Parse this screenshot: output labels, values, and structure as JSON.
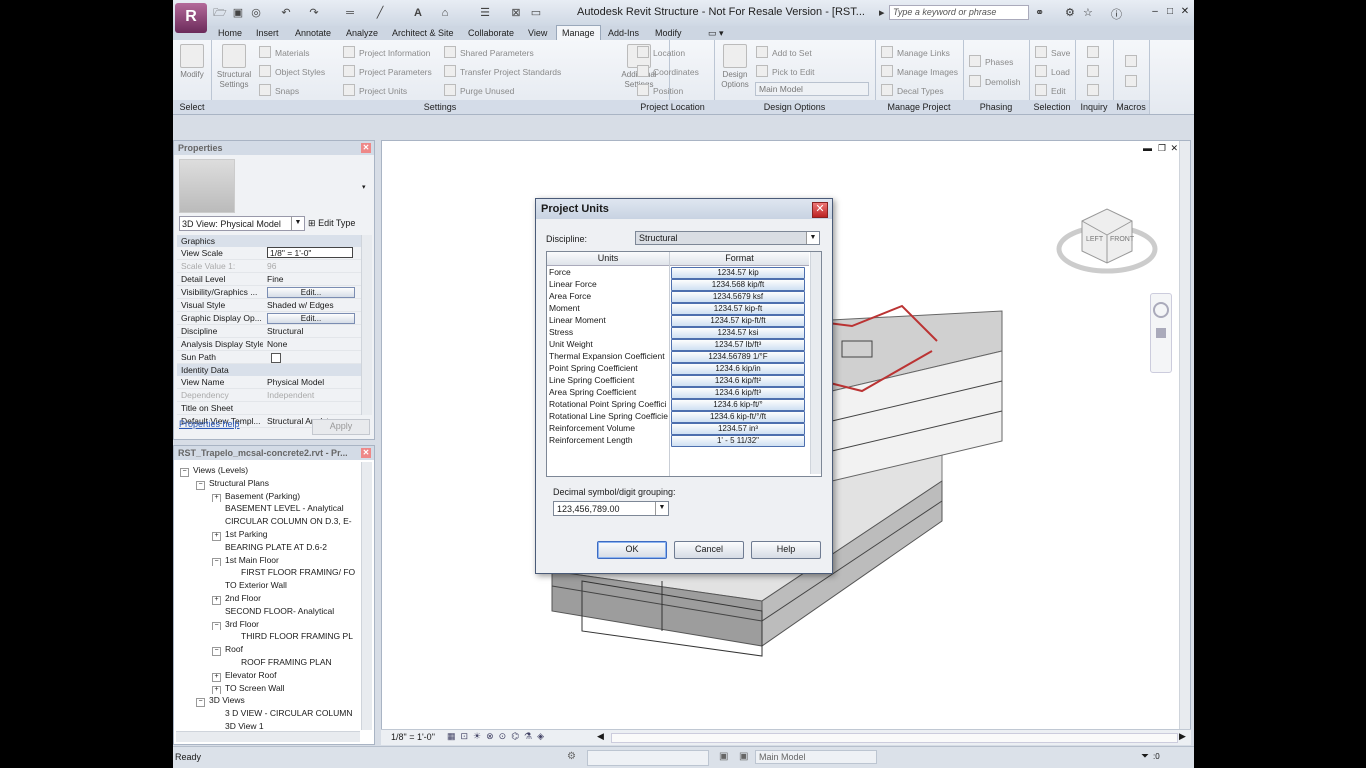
{
  "titlebar": {
    "app_letter": "R",
    "title": "Autodesk Revit Structure - Not For Resale Version - [RST...",
    "search_placeholder": "Type a keyword or phrase"
  },
  "tabs": [
    "Home",
    "Insert",
    "Annotate",
    "Analyze",
    "Architect & Site",
    "Collaborate",
    "View",
    "Manage",
    "Add-Ins",
    "Modify"
  ],
  "active_tab": "Manage",
  "ribbon": {
    "select": {
      "title": "Select",
      "modify": "Modify"
    },
    "settings": {
      "title": "Settings",
      "structural_settings": "Structural Settings",
      "materials": "Materials",
      "object_styles": "Object Styles",
      "snaps": "Snaps",
      "project_information": "Project Information",
      "project_parameters": "Project Parameters",
      "project_units": "Project Units",
      "shared_parameters": "Shared Parameters",
      "transfer_standards": "Transfer Project Standards",
      "purge_unused": "Purge Unused",
      "additional_settings": "Additional Settings"
    },
    "project_location": {
      "title": "Project Location",
      "location": "Location",
      "coordinates": "Coordinates",
      "position": "Position"
    },
    "design_options": {
      "title": "Design Options",
      "design_options": "Design Options",
      "add_to_set": "Add to Set",
      "pick_to_edit": "Pick to Edit",
      "main_model": "Main Model"
    },
    "manage_project": {
      "title": "Manage Project",
      "manage_links": "Manage Links",
      "manage_images": "Manage Images",
      "decal_types": "Decal Types"
    },
    "phasing": {
      "title": "Phasing",
      "phases": "Phases",
      "demolish": "Demolish"
    },
    "selection": {
      "title": "Selection",
      "save": "Save",
      "load": "Load",
      "edit": "Edit"
    },
    "inquiry": {
      "title": "Inquiry"
    },
    "macros": {
      "title": "Macros"
    }
  },
  "properties": {
    "title": "Properties",
    "type": "3D View: Physical Model",
    "edit_type": "Edit Type",
    "groups": [
      {
        "name": "Graphics",
        "rows": [
          {
            "k": "View Scale",
            "v": "1/8\" = 1'-0\"",
            "kind": "input"
          },
          {
            "k": "Scale Value    1:",
            "v": "96",
            "kind": "grey"
          },
          {
            "k": "Detail Level",
            "v": "Fine"
          },
          {
            "k": "Visibility/Graphics ...",
            "v": "Edit...",
            "kind": "button"
          },
          {
            "k": "Visual Style",
            "v": "Shaded w/ Edges"
          },
          {
            "k": "Graphic Display Op...",
            "v": "Edit...",
            "kind": "button"
          },
          {
            "k": "Discipline",
            "v": "Structural"
          },
          {
            "k": "Analysis Display Style",
            "v": "None"
          },
          {
            "k": "Sun Path",
            "v": "",
            "kind": "check"
          }
        ]
      },
      {
        "name": "Identity Data",
        "rows": [
          {
            "k": "View Name",
            "v": "Physical Model"
          },
          {
            "k": "Dependency",
            "v": "Independent",
            "kind": "grey"
          },
          {
            "k": "Title on Sheet",
            "v": ""
          },
          {
            "k": "Default View Templ...",
            "v": "Structural Analyt..."
          }
        ]
      }
    ],
    "help": "Properties help",
    "apply": "Apply"
  },
  "browser": {
    "title": "RST_Trapelo_mcsal-concrete2.rvt - Pr...",
    "items": [
      {
        "t": "Views (Levels)",
        "lvl": 0,
        "pm": "-"
      },
      {
        "t": "Structural Plans",
        "lvl": 1,
        "pm": "-"
      },
      {
        "t": "Basement (Parking)",
        "lvl": 2,
        "pm": "+"
      },
      {
        "t": "BASEMENT LEVEL - Analytical",
        "lvl": 2,
        "pm": ""
      },
      {
        "t": "CIRCULAR COLUMN ON D.3, E-",
        "lvl": 2,
        "pm": ""
      },
      {
        "t": "1st Parking",
        "lvl": 2,
        "pm": "+"
      },
      {
        "t": "BEARING PLATE AT D.6-2",
        "lvl": 2,
        "pm": ""
      },
      {
        "t": "1st Main Floor",
        "lvl": 2,
        "pm": "-"
      },
      {
        "t": "FIRST FLOOR FRAMING/ FO",
        "lvl": 3,
        "pm": ""
      },
      {
        "t": "TO Exterior Wall",
        "lvl": 2,
        "pm": ""
      },
      {
        "t": "2nd Floor",
        "lvl": 2,
        "pm": "+"
      },
      {
        "t": "SECOND FLOOR- Analytical",
        "lvl": 2,
        "pm": ""
      },
      {
        "t": "3rd Floor",
        "lvl": 2,
        "pm": "-"
      },
      {
        "t": "THIRD FLOOR FRAMING PL",
        "lvl": 3,
        "pm": ""
      },
      {
        "t": "Roof",
        "lvl": 2,
        "pm": "-"
      },
      {
        "t": "ROOF FRAMING PLAN",
        "lvl": 3,
        "pm": ""
      },
      {
        "t": "Elevator Roof",
        "lvl": 2,
        "pm": "+"
      },
      {
        "t": "TO Screen Wall",
        "lvl": 2,
        "pm": "+"
      },
      {
        "t": "3D Views",
        "lvl": 1,
        "pm": "-"
      },
      {
        "t": "3 D VIEW - CIRCULAR COLUMN",
        "lvl": 2,
        "pm": ""
      },
      {
        "t": "3D View 1",
        "lvl": 2,
        "pm": ""
      }
    ]
  },
  "viewcube": {
    "left": "LEFT",
    "front": "FRONT"
  },
  "viewbar": {
    "scale": "1/8\" = 1'-0\""
  },
  "status": {
    "text": "Ready",
    "model": "Main Model",
    "filter": ":0"
  },
  "dialog": {
    "title": "Project Units",
    "discipline_label": "Discipline:",
    "discipline_value": "Structural",
    "col_units": "Units",
    "col_format": "Format",
    "rows": [
      {
        "unit": "Force",
        "format": "1234.57 kip"
      },
      {
        "unit": "Linear Force",
        "format": "1234.568 kip/ft"
      },
      {
        "unit": "Area Force",
        "format": "1234.5679 ksf"
      },
      {
        "unit": "Moment",
        "format": "1234.57 kip-ft"
      },
      {
        "unit": "Linear Moment",
        "format": "1234.57 kip-ft/ft"
      },
      {
        "unit": "Stress",
        "format": "1234.57 ksi"
      },
      {
        "unit": "Unit Weight",
        "format": "1234.57 lb/ft³"
      },
      {
        "unit": "Thermal Expansion Coefficient",
        "format": "1234.56789 1/°F"
      },
      {
        "unit": "Point Spring Coefficient",
        "format": "1234.6 kip/in"
      },
      {
        "unit": "Line Spring Coefficient",
        "format": "1234.6 kip/ft²"
      },
      {
        "unit": "Area Spring Coefficient",
        "format": "1234.6 kip/ft³"
      },
      {
        "unit": "Rotational Point Spring Coeffici",
        "format": "1234.6 kip-ft/°"
      },
      {
        "unit": "Rotational Line Spring Coefficie",
        "format": "1234.6 kip-ft/°/ft"
      },
      {
        "unit": "Reinforcement Volume",
        "format": "1234.57 in³"
      },
      {
        "unit": "Reinforcement Length",
        "format": "1' - 5 11/32\""
      }
    ],
    "decimal_label": "Decimal symbol/digit grouping:",
    "decimal_value": "123,456,789.00",
    "ok": "OK",
    "cancel": "Cancel",
    "help": "Help"
  }
}
